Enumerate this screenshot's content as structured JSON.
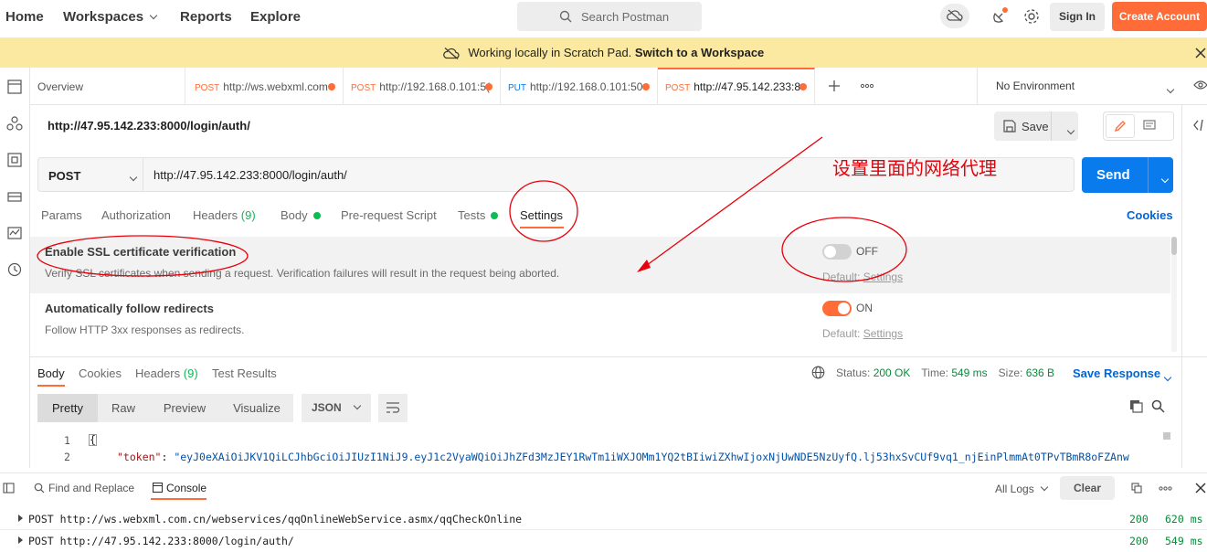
{
  "topnav": {
    "home": "Home",
    "workspaces": "Workspaces",
    "reports": "Reports",
    "explore": "Explore",
    "search_placeholder": "Search Postman",
    "sign_in": "Sign In",
    "create_account": "Create Account"
  },
  "banner": {
    "text": "Working locally in Scratch Pad.",
    "link": "Switch to a Workspace"
  },
  "tabs": {
    "overview": "Overview",
    "items": [
      {
        "method": "POST",
        "url": "http://ws.webxml.com"
      },
      {
        "method": "POST",
        "url": "http://192.168.0.101:5("
      },
      {
        "method": "PUT",
        "url": "http://192.168.0.101:50"
      },
      {
        "method": "POST",
        "url": "http://47.95.142.233:8"
      }
    ],
    "environment": "No Environment"
  },
  "request": {
    "title": "http://47.95.142.233:8000/login/auth/",
    "save": "Save",
    "method": "POST",
    "url": "http://47.95.142.233:8000/login/auth/",
    "send": "Send"
  },
  "annotation": {
    "note": "设置里面的网络代理"
  },
  "request_tabs": {
    "params": "Params",
    "authorization": "Authorization",
    "headers": "Headers",
    "headers_count": "(9)",
    "body": "Body",
    "prerequest": "Pre-request Script",
    "tests": "Tests",
    "settings": "Settings",
    "cookies": "Cookies"
  },
  "settings": [
    {
      "title": "Enable SSL certificate verification",
      "desc": "Verify SSL certificates when sending a request. Verification failures will result in the request being aborted.",
      "state": "OFF",
      "default_prefix": "Default:",
      "default_link": "Settings"
    },
    {
      "title": "Automatically follow redirects",
      "desc": "Follow HTTP 3xx responses as redirects.",
      "state": "ON",
      "default_prefix": "Default:",
      "default_link": "Settings"
    }
  ],
  "response": {
    "tabs": {
      "body": "Body",
      "cookies": "Cookies",
      "headers": "Headers",
      "headers_count": "(9)",
      "tests": "Test Results"
    },
    "status_label": "Status:",
    "status_value": "200 OK",
    "time_label": "Time:",
    "time_value": "549 ms",
    "size_label": "Size:",
    "size_value": "636 B",
    "save_response": "Save Response",
    "views": {
      "pretty": "Pretty",
      "raw": "Raw",
      "preview": "Preview",
      "visualize": "Visualize"
    },
    "format": "JSON",
    "lines": [
      {
        "num": "1",
        "text": "{"
      },
      {
        "num": "2",
        "key": "\"token\"",
        "value": "\"eyJ0eXAiOiJKV1QiLCJhbGciOiJIUzI1NiJ9.eyJ1c2VyaWQiOiJhZFd3MzJEY1RwTm1iWXJOMm1YQ2tBIiwiZXhwIjoxNjUwNDE5NzUyfQ.lj53hxSvCUf9vq1_njEinPlmmAt0TPvTBmR8oFZAnw"
      }
    ]
  },
  "console": {
    "find_replace": "Find and Replace",
    "console_tab": "Console",
    "all_logs": "All Logs",
    "clear": "Clear",
    "logs": [
      {
        "method": "POST",
        "url": "http://ws.webxml.com.cn/webservices/qqOnlineWebService.asmx/qqCheckOnline",
        "status": "200",
        "time": "620 ms"
      },
      {
        "method": "POST",
        "url": "http://47.95.142.233:8000/login/auth/",
        "status": "200",
        "time": "549 ms"
      }
    ]
  },
  "colors": {
    "accent": "#ff6c37",
    "send_blue": "#097bed",
    "link_blue": "#0265d2",
    "banner": "#fce9a1",
    "annotation_red": "#e8000b",
    "ok_green": "#0cbb52"
  }
}
